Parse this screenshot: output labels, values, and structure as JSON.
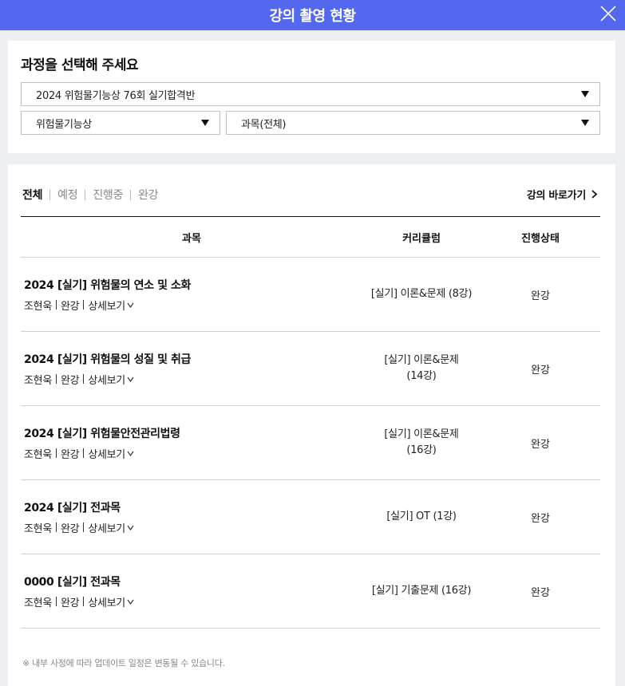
{
  "header": {
    "title": "강의 촬영 현황"
  },
  "selector": {
    "title": "과정을 선택해 주세요",
    "course_value": "2024 위험물기능상 76회 실기합격반",
    "cert_value": "위험물기능상",
    "subject_value": "과목(전체)"
  },
  "tabs": [
    {
      "label": "전체",
      "active": true
    },
    {
      "label": "예정",
      "active": false
    },
    {
      "label": "진행중",
      "active": false
    },
    {
      "label": "완강",
      "active": false
    }
  ],
  "shortcut_label": "강의 바로가기",
  "table": {
    "headers": {
      "subject": "과목",
      "curriculum": "커리큘럼",
      "status": "진행상태"
    },
    "rows": [
      {
        "title": "2024 [실기] 위험물의 연소 및 소화",
        "teacher": "조현욱",
        "state": "완강",
        "detail": "상세보기",
        "curriculum": "[실기] 이론&문제 (8강)",
        "status": "완강"
      },
      {
        "title": "2024 [실기] 위험물의 성질 및 취급",
        "teacher": "조현욱",
        "state": "완강",
        "detail": "상세보기",
        "curriculum": "[실기] 이론&문제 (14강)",
        "status": "완강"
      },
      {
        "title": "2024 [실기] 위험물안전관리법령",
        "teacher": "조현욱",
        "state": "완강",
        "detail": "상세보기",
        "curriculum": "[실기] 이론&문제 (16강)",
        "status": "완강"
      },
      {
        "title": "2024 [실기] 전과목",
        "teacher": "조현욱",
        "state": "완강",
        "detail": "상세보기",
        "curriculum": "[실기] OT (1강)",
        "status": "완강"
      },
      {
        "title": "0000 [실기] 전과목",
        "teacher": "조현욱",
        "state": "완강",
        "detail": "상세보기",
        "curriculum": "[실기] 기출문제 (16강)",
        "status": "완강"
      }
    ]
  },
  "notice": "※ 내부 사정에 따라 업데이트 일정은 변동될 수 있습니다.",
  "colors": {
    "header_bg": "#5468ef",
    "page_bg": "#eeeff3"
  }
}
